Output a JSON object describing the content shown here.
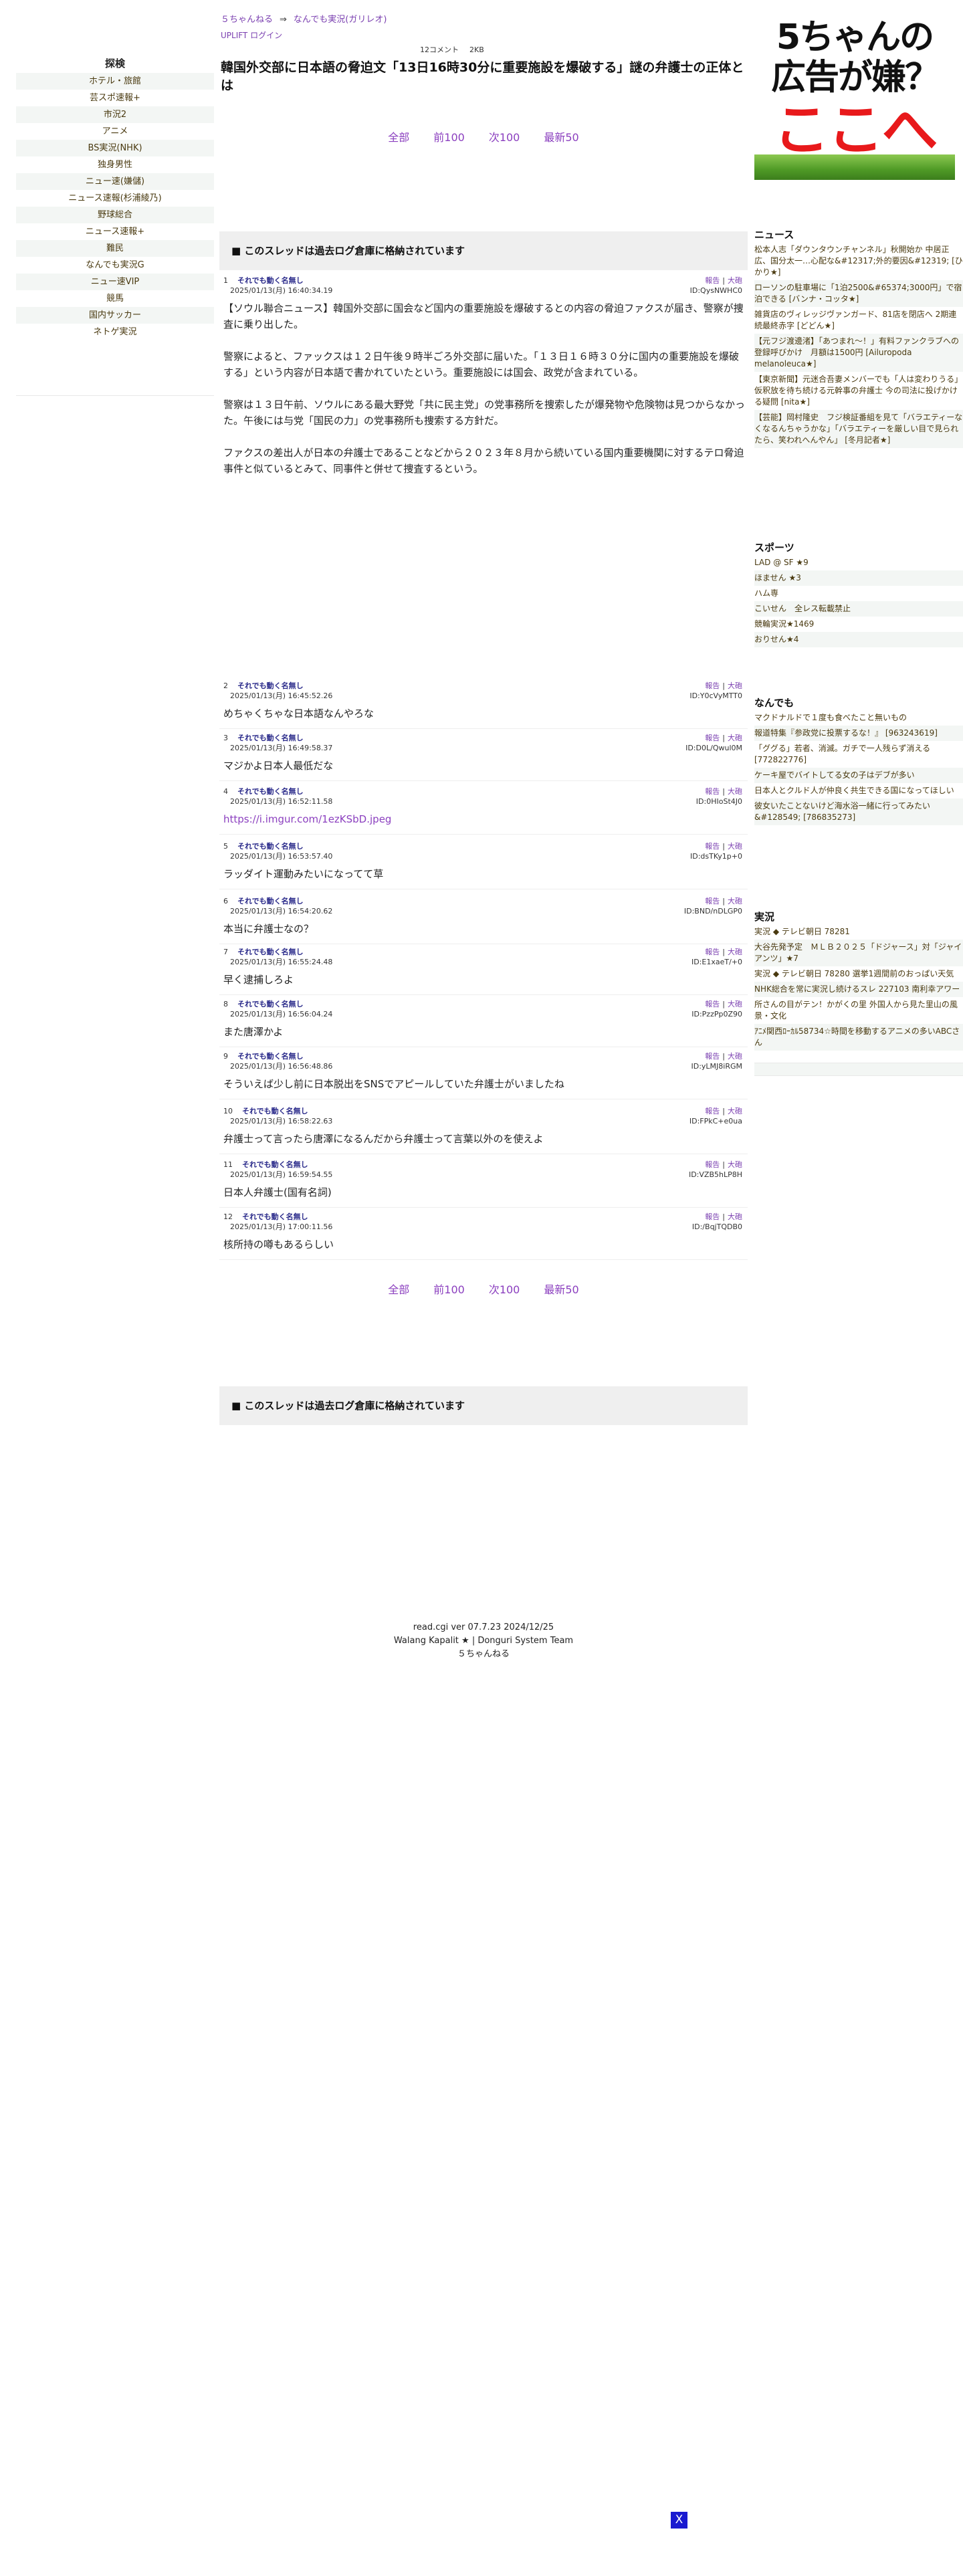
{
  "left": {
    "title": "探検",
    "items": [
      "ホテル・旅館",
      "芸スポ速報+",
      "市況2",
      "アニメ",
      "BS実況(NHK)",
      "独身男性",
      "ニュー速(嫌儲)",
      "ニュース速報(杉浦綾乃)",
      "野球総合",
      "ニュース速報+",
      "難民",
      "なんでも実況G",
      "ニュー速VIP",
      "競馬",
      "国内サッカー",
      "ネトゲ実況"
    ]
  },
  "header": {
    "crumb_site": "５ちゃんねる",
    "crumb_arrow": "⇒",
    "crumb_board": "なんでも実況(ガリレオ)",
    "login": "UPLIFT ログイン",
    "comments": "12コメント",
    "size": "2KB",
    "title": "韓国外交部に日本語の脅迫文「13日16時30分に重要施設を爆破する」謎の弁護士の正体とは"
  },
  "pager": {
    "all": "全部",
    "prev": "前100",
    "next": "次100",
    "latest": "最新50"
  },
  "notice": "■ このスレッドは過去ログ倉庫に格納されています",
  "tools": {
    "report": "報告",
    "sep": "|",
    "block": "大砲"
  },
  "posts": [
    {
      "num": "1",
      "name": "それでも動く名無し",
      "date": "2025/01/13(月) 16:40:34.19",
      "id": "ID:QysNWHC0",
      "body": "【ソウル聯合ニュース】韓国外交部に国会など国内の重要施設を爆破するとの内容の脅迫ファクスが届き、警察が捜査に乗り出した。\n\n警察によると、ファックスは１２日午後９時半ごろ外交部に届いた。「１３日１６時３０分に国内の重要施設を爆破する」という内容が日本語で書かれていたという。重要施設には国会、政党が含まれている。\n\n警察は１３日午前、ソウルにある最大野党「共に民主党」の党事務所を捜索したが爆発物や危険物は見つからなかった。午後には与党「国民の力」の党事務所も捜索する方針だ。\n\nファクスの差出人が日本の弁護士であることなどから２０２３年８月から続いている国内重要機関に対するテロ脅迫事件と似ているとみて、同事件と併せて捜査するという。"
    },
    {
      "num": "2",
      "name": "それでも動く名無し",
      "date": "2025/01/13(月) 16:45:52.26",
      "id": "ID:Y0cVyMTT0",
      "body": "めちゃくちゃな日本語なんやろな"
    },
    {
      "num": "3",
      "name": "それでも動く名無し",
      "date": "2025/01/13(月) 16:49:58.37",
      "id": "ID:D0L/Qwul0M",
      "body": "マジかよ日本人最低だな"
    },
    {
      "num": "4",
      "name": "それでも動く名無し",
      "date": "2025/01/13(月) 16:52:11.58",
      "id": "ID:0HIoSt4J0",
      "body": "https://i.imgur.com/1ezKSbD.jpeg"
    },
    {
      "num": "5",
      "name": "それでも動く名無し",
      "date": "2025/01/13(月) 16:53:57.40",
      "id": "ID:dsTKy1p+0",
      "body": "ラッダイト運動みたいになってて草"
    },
    {
      "num": "6",
      "name": "それでも動く名無し",
      "date": "2025/01/13(月) 16:54:20.62",
      "id": "ID:BND/nDLGP0",
      "body": "本当に弁護士なの？"
    },
    {
      "num": "7",
      "name": "それでも動く名無し",
      "date": "2025/01/13(月) 16:55:24.48",
      "id": "ID:E1xaeT/+0",
      "body": "早く逮捕しろよ"
    },
    {
      "num": "8",
      "name": "それでも動く名無し",
      "date": "2025/01/13(月) 16:56:04.24",
      "id": "ID:PzzPp0Z90",
      "body": "また唐澤かよ"
    },
    {
      "num": "9",
      "name": "それでも動く名無し",
      "date": "2025/01/13(月) 16:56:48.86",
      "id": "ID:yLMJ8iRGM",
      "body": "そういえば少し前に日本脱出をSNSでアピールしていた弁護士がいましたね"
    },
    {
      "num": "10",
      "name": "それでも動く名無し",
      "date": "2025/01/13(月) 16:58:22.63",
      "id": "ID:FPkC+e0ua",
      "body": "弁護士って言ったら唐澤になるんだから弁護士って言葉以外のを使えよ"
    },
    {
      "num": "11",
      "name": "それでも動く名無し",
      "date": "2025/01/13(月) 16:59:54.55",
      "id": "ID:VZB5hLP8H",
      "body": "日本人弁護士(国有名詞)"
    },
    {
      "num": "12",
      "name": "それでも動く名無し",
      "date": "2025/01/13(月) 17:00:11.56",
      "id": "ID:/BqjTQDB0",
      "body": "核所持の噂もあるらしい"
    }
  ],
  "footer": {
    "line1": "read.cgi ver 07.7.23 2024/12/25",
    "line2": "Walang Kapalit ★ | Donguri System Team",
    "line3": "５ちゃんねる"
  },
  "ad": {
    "line1": "5ちゃんの",
    "line2": "広告が嫌？",
    "line3": "ここへ"
  },
  "right": {
    "news": {
      "title": "ニュース",
      "items": [
        "松本人志「ダウンタウンチャンネル」秋開始か 中居正広、国分太一…心配な&#12317;外的要因&#12319; [ひかり★]",
        "ローソンの駐車場に「1泊2500&#65374;3000円」で宿泊できる [バンナ・コッタ★]",
        "雑貨店のヴィレッジヴァンガード、81店を閉店へ 2期連続最終赤字 [どどん★]",
        "【元フジ渡邊渚】「あつまれ～！」有料ファンクラブへの登録呼びかけ　月額は1500円 [Ailuropoda melanoleuca★]",
        "【東京新聞】元迷合吾妻メンバーでも「人は変わりうる」 仮釈放を待ち続ける元幹事の弁護士 今の司法に投げかける疑問 [nita★]",
        "【芸能】岡村隆史　フジ検証番組を見て「バラエティーなくなるんちゃうかな」「バラエティーを厳しい目で見られたら、笑われへんやん」 [冬月記者★]"
      ]
    },
    "sports": {
      "title": "スポーツ",
      "items": [
        "LAD @ SF ★9",
        "ほません ★3",
        "ハム専",
        "こいせん　全レス転載禁止",
        "競輪実況★1469",
        "おりせん★4"
      ]
    },
    "nandemo": {
      "title": "なんでも",
      "items": [
        "マクドナルドで１度も食べたこと無いもの",
        "報道特集『参政党に投票するな！』 [963243619]",
        "「ググる」若者、消滅。ガチで一人残らず消える [772822776]",
        "ケーキ屋でバイトしてる女の子はデブが多い",
        "日本人とクルド人が仲良く共生できる国になってほしい",
        "彼女いたことないけど海水浴一緒に行ってみたい &#128549; [786835273]"
      ]
    },
    "jikkyo": {
      "title": "実況",
      "items": [
        "実況 ◆ テレビ朝日 78281",
        "大谷先発予定　ＭＬＢ２０２５「ドジャース」対「ジャイアンツ」★7",
        "実況 ◆ テレビ朝日 78280 選挙1週間前のおっぱい天気",
        "NHK総合を常に実況し続けるスレ 227103 南利幸アワー",
        "所さんの目がテン！かがくの里 外国人から見た里山の風景・文化",
        "ｱﾆﾒ関西ﾛｰｶﾙ58734☆時間を移動するアニメの多いABCさん"
      ]
    }
  },
  "close_label": "X"
}
